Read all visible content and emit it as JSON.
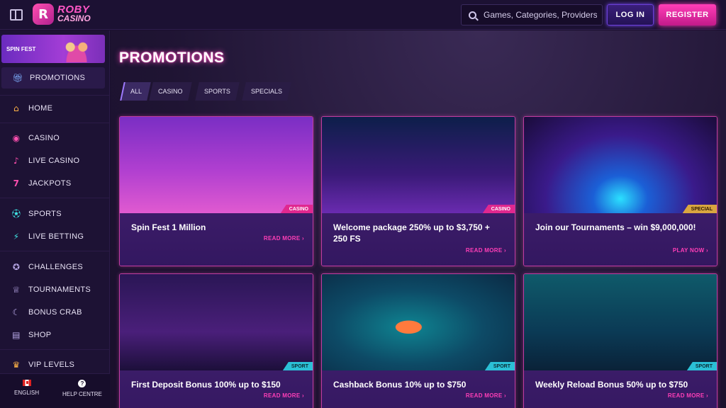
{
  "header": {
    "logo_line1": "ROBY",
    "logo_line2": "CASINO",
    "logo_mark": "R",
    "search_placeholder": "Games, Categories, Providers",
    "login_label": "LOG IN",
    "register_label": "REGISTER"
  },
  "sidebar": {
    "banner_label": "SPIN FEST",
    "items": [
      {
        "label": "PROMOTIONS",
        "icon": "gift-icon",
        "glyph": "🎁︎",
        "active": true
      },
      {
        "label": "HOME",
        "icon": "home-icon",
        "glyph": "⌂"
      },
      {
        "label": "CASINO",
        "icon": "casino-chip-icon",
        "glyph": "◉"
      },
      {
        "label": "LIVE CASINO",
        "icon": "microphone-icon",
        "glyph": "♪"
      },
      {
        "label": "JACKPOTS",
        "icon": "seven-icon",
        "glyph": "7"
      },
      {
        "label": "SPORTS",
        "icon": "soccer-ball-icon",
        "glyph": "⚽︎"
      },
      {
        "label": "LIVE BETTING",
        "icon": "lightning-icon",
        "glyph": "⚡︎"
      },
      {
        "label": "CHALLENGES",
        "icon": "medal-icon",
        "glyph": "✪"
      },
      {
        "label": "TOURNAMENTS",
        "icon": "trophy-icon",
        "glyph": "♕"
      },
      {
        "label": "BONUS CRAB",
        "icon": "crab-claw-icon",
        "glyph": "☾"
      },
      {
        "label": "SHOP",
        "icon": "cart-icon",
        "glyph": "▤"
      },
      {
        "label": "VIP LEVELS",
        "icon": "crown-icon",
        "glyph": "♛"
      }
    ],
    "footer": {
      "language_label": "ENGLISH",
      "help_label": "HELP CENTRE",
      "help_glyph": "?"
    }
  },
  "main": {
    "title": "PROMOTIONS",
    "filters": [
      "ALL",
      "CASINO",
      "SPORTS",
      "SPECIALS"
    ],
    "cards": [
      {
        "title": "Spin Fest 1 Million",
        "tag": "CASINO",
        "link": "READ MORE ›"
      },
      {
        "title": "Welcome package 250% up to $3,750 + 250 FS",
        "tag": "CASINO",
        "link": "READ MORE ›"
      },
      {
        "title": "Join our Tournaments – win $9,000,000!",
        "tag": "SPECIAL",
        "link": "PLAY NOW ›"
      },
      {
        "title": "First Deposit Bonus 100% up to $150",
        "tag": "SPORT",
        "link": "READ MORE ›"
      },
      {
        "title": "Cashback Bonus 10% up to $750",
        "tag": "SPORT",
        "link": "READ MORE ›"
      },
      {
        "title": "Weekly Reload Bonus 50% up to $750",
        "tag": "SPORT",
        "link": "READ MORE ›"
      }
    ]
  },
  "colors": {
    "accent_pink": "#ff3eb7",
    "accent_purple": "#6b3fd6",
    "background": "#1a0f2e"
  }
}
